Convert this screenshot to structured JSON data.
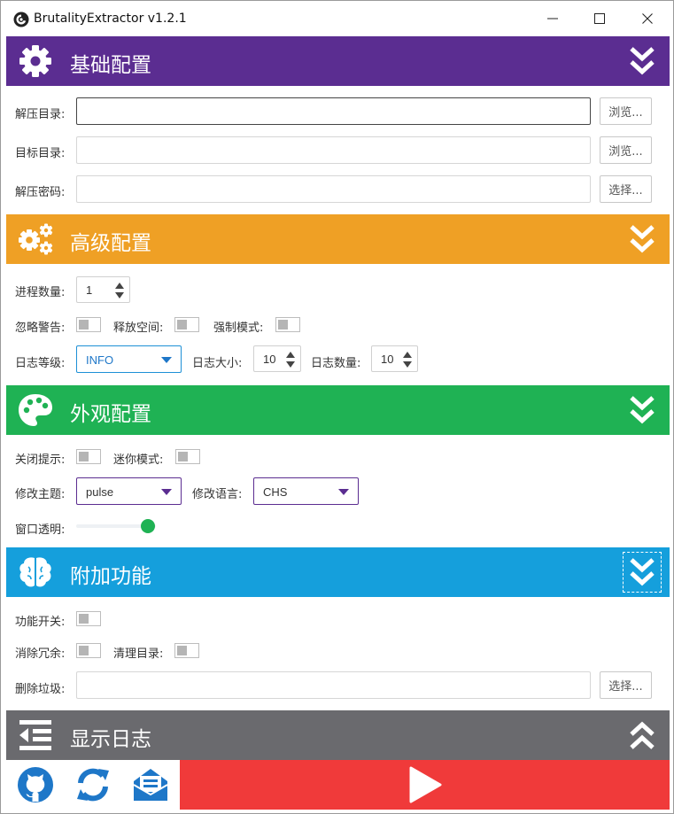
{
  "window": {
    "title": "BrutalityExtractor v1.2.1"
  },
  "colors": {
    "basic": "#5b2d91",
    "advanced": "#efa025",
    "appearance": "#1fb254",
    "extra": "#159fdc",
    "log": "#6a6a6e",
    "run": "#f03a3a",
    "icon_blue": "#1e77c8"
  },
  "basic": {
    "title": "基础配置",
    "icon": "gear-icon",
    "unzip_dir_label": "解压目录:",
    "unzip_dir_value": "",
    "target_dir_label": "目标目录:",
    "target_dir_value": "",
    "password_label": "解压密码:",
    "password_value": "",
    "browse_label": "浏览...",
    "select_label": "选择..."
  },
  "advanced": {
    "title": "高级配置",
    "icon": "gears-icon",
    "process_count_label": "进程数量:",
    "process_count_value": "1",
    "ignore_warning_label": "忽略警告:",
    "free_space_label": "释放空间:",
    "force_mode_label": "强制模式:",
    "log_level_label": "日志等级:",
    "log_level_value": "INFO",
    "log_size_label": "日志大小:",
    "log_size_value": "10",
    "log_count_label": "日志数量:",
    "log_count_value": "10"
  },
  "appearance": {
    "title": "外观配置",
    "icon": "palette-icon",
    "close_tip_label": "关闭提示:",
    "mini_mode_label": "迷你模式:",
    "theme_label": "修改主题:",
    "theme_value": "pulse",
    "language_label": "修改语言:",
    "language_value": "CHS",
    "opacity_label": "窗口透明:",
    "opacity_value": 1.0
  },
  "extra": {
    "title": "附加功能",
    "icon": "brain-icon",
    "feature_switch_label": "功能开关:",
    "remove_redundant_label": "消除冗余:",
    "clean_dir_label": "清理目录:",
    "delete_garbage_label": "删除垃圾:",
    "delete_garbage_value": "",
    "select_label": "选择..."
  },
  "log": {
    "title": "显示日志",
    "icon": "log-icon"
  },
  "footer": {
    "github": "github-icon",
    "refresh": "refresh-icon",
    "mail": "mail-icon",
    "run": "play-icon"
  }
}
